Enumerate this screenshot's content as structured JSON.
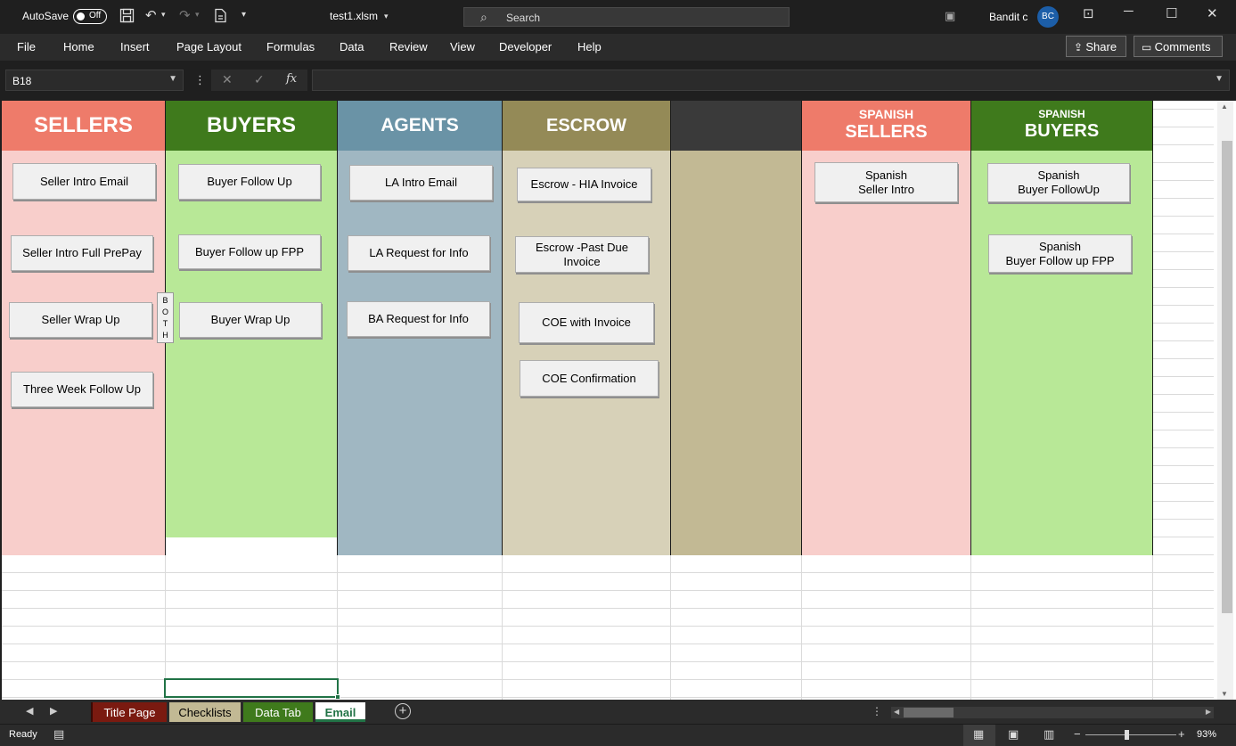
{
  "titlebar": {
    "autosave_label": "AutoSave",
    "autosave_state": "Off",
    "filename": "test1.xlsm",
    "search_placeholder": "Search",
    "user_name": "Bandit c",
    "user_initials": "BC"
  },
  "ribbon": {
    "tabs": [
      "File",
      "Home",
      "Insert",
      "Page Layout",
      "Formulas",
      "Data",
      "Review",
      "View",
      "Developer",
      "Help"
    ],
    "share_label": "Share",
    "comments_label": "Comments"
  },
  "formula_bar": {
    "name_box": "B18",
    "fx_label": "fx",
    "value": ""
  },
  "columns": {
    "sellers": {
      "title": "SELLERS",
      "color": "#EE7B6A",
      "body_color": "#F8CECB"
    },
    "buyers": {
      "title": "BUYERS",
      "color": "#3F7A1C",
      "body_color": "#B8E897"
    },
    "agents": {
      "title": "AGENTS",
      "color": "#6A93A6",
      "body_color": "#A0B7C2"
    },
    "escrow": {
      "title": "ESCROW",
      "color": "#948A57",
      "body_color": "#D7D1B8"
    },
    "blank": {
      "color": "#3A3A3A",
      "body_color": "#C2B994"
    },
    "spanish_sellers": {
      "subtitle": "SPANISH",
      "title": "SELLERS",
      "color": "#EE7B6A",
      "body_color": "#F8CECB"
    },
    "spanish_buyers": {
      "subtitle": "SPANISH",
      "title": "BUYERS",
      "color": "#3F7A1C",
      "body_color": "#B8E897"
    }
  },
  "buttons": {
    "seller_intro_email": "Seller Intro Email",
    "seller_intro_full_prepay": "Seller Intro Full PrePay",
    "seller_wrap_up": "Seller Wrap Up",
    "three_week_follow_up": "Three Week Follow Up",
    "both_label": "B O T H",
    "buyer_follow_up": "Buyer Follow Up",
    "buyer_follow_up_fpp": "Buyer Follow up FPP",
    "buyer_wrap_up": "Buyer Wrap Up",
    "la_intro_email": "LA Intro Email",
    "la_request_for_info": "LA Request for Info",
    "ba_request_for_info": "BA Request for Info",
    "escrow_hia_invoice": "Escrow - HIA Invoice",
    "escrow_past_due_line1": "Escrow -Past Due",
    "escrow_past_due_line2": "Invoice",
    "coe_with_invoice": "COE with Invoice",
    "coe_confirmation": "COE Confirmation",
    "spanish_seller_intro_line1": "Spanish",
    "spanish_seller_intro_line2": "Seller Intro",
    "spanish_buyer_followup_line1": "Spanish",
    "spanish_buyer_followup_line2": "Buyer FollowUp",
    "spanish_buyer_fpp_line1": "Spanish",
    "spanish_buyer_fpp_line2": "Buyer Follow up FPP"
  },
  "sheet_tabs": [
    {
      "label": "Title Page",
      "color": "#7A1A10",
      "text_color": "#FFFFFF"
    },
    {
      "label": "Checklists",
      "color": "#C2B994",
      "text_color": "#000000"
    },
    {
      "label": "Data Tab",
      "color": "#3F7A1C",
      "text_color": "#FFFFFF"
    },
    {
      "label": "Email",
      "color": "#FFFFFF",
      "text_color": "#217346",
      "active": true
    }
  ],
  "status": {
    "ready": "Ready",
    "zoom": "93%"
  }
}
